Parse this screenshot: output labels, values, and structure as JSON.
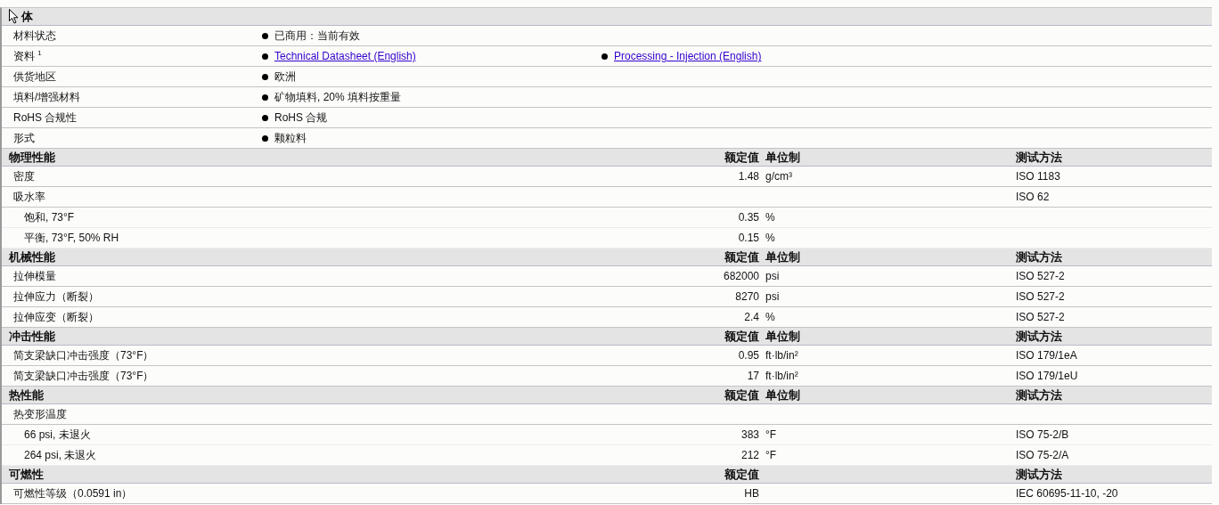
{
  "sections": [
    {
      "title": "体",
      "kind": "info",
      "rows": [
        {
          "label": "材料状态",
          "values": [
            {
              "kind": "text",
              "text": "已商用：当前有效"
            }
          ]
        },
        {
          "label": "资料 $^{1}$",
          "values": [
            {
              "kind": "link",
              "text": "Technical Datasheet (English)"
            },
            {
              "kind": "link",
              "text": "Processing - Injection (English)"
            }
          ]
        },
        {
          "label": "供货地区",
          "values": [
            {
              "kind": "text",
              "text": "欧洲"
            }
          ]
        },
        {
          "label": "填料/增强材料",
          "values": [
            {
              "kind": "text",
              "text": "矿物填料, 20% 填料按重量"
            }
          ]
        },
        {
          "label": "RoHS 合规性",
          "values": [
            {
              "kind": "text",
              "text": "RoHS 合规"
            }
          ]
        },
        {
          "label": "形式",
          "values": [
            {
              "kind": "text",
              "text": "颗粒料"
            }
          ]
        }
      ]
    },
    {
      "title": "物理性能",
      "kind": "data",
      "value_heading": "额定值",
      "unit_heading": "单位制",
      "method_heading": "测试方法",
      "rows": [
        {
          "label": "密度",
          "value": "1.48",
          "unit": "g/cm³",
          "method": "ISO 1183"
        },
        {
          "label": "吸水率",
          "method": "ISO 62",
          "children": [
            {
              "label": "饱和, 73°F",
              "value": "0.35",
              "unit": "%"
            },
            {
              "label": "平衡, 73°F, 50% RH",
              "value": "0.15",
              "unit": "%"
            }
          ]
        }
      ]
    },
    {
      "title": "机械性能",
      "kind": "data",
      "value_heading": "额定值",
      "unit_heading": "单位制",
      "method_heading": "测试方法",
      "rows": [
        {
          "label": "拉伸模量",
          "value": "682000",
          "unit": "psi",
          "method": "ISO 527-2"
        },
        {
          "label": "拉伸应力（断裂）",
          "value": "8270",
          "unit": "psi",
          "method": "ISO 527-2"
        },
        {
          "label": "拉伸应变（断裂）",
          "value": "2.4",
          "unit": "%",
          "method": "ISO 527-2"
        }
      ]
    },
    {
      "title": "冲击性能",
      "kind": "data",
      "value_heading": "额定值",
      "unit_heading": "单位制",
      "method_heading": "测试方法",
      "rows": [
        {
          "label": "简支梁缺口冲击强度（73°F）",
          "value": "0.95",
          "unit": "ft·lb/in²",
          "method": "ISO 179/1eA"
        },
        {
          "label": "简支梁缺口冲击强度（73°F）",
          "value": "17",
          "unit": "ft·lb/in²",
          "method": "ISO 179/1eU"
        }
      ]
    },
    {
      "title": "热性能",
      "kind": "data",
      "value_heading": "额定值",
      "unit_heading": "单位制",
      "method_heading": "测试方法",
      "rows": [
        {
          "label": "热变形温度",
          "children": [
            {
              "label": "66 psi, 未退火",
              "value": "383",
              "unit": "°F",
              "method": "ISO 75-2/B"
            },
            {
              "label": "264 psi, 未退火",
              "value": "212",
              "unit": "°F",
              "method": "ISO 75-2/A"
            }
          ]
        }
      ]
    },
    {
      "title": "可燃性",
      "kind": "data",
      "value_heading": "额定值",
      "method_heading": "测试方法",
      "rows": [
        {
          "label": "可燃性等级（0.0591 in）",
          "value": "HB",
          "method": "IEC 60695-11-10, -20"
        }
      ]
    }
  ]
}
